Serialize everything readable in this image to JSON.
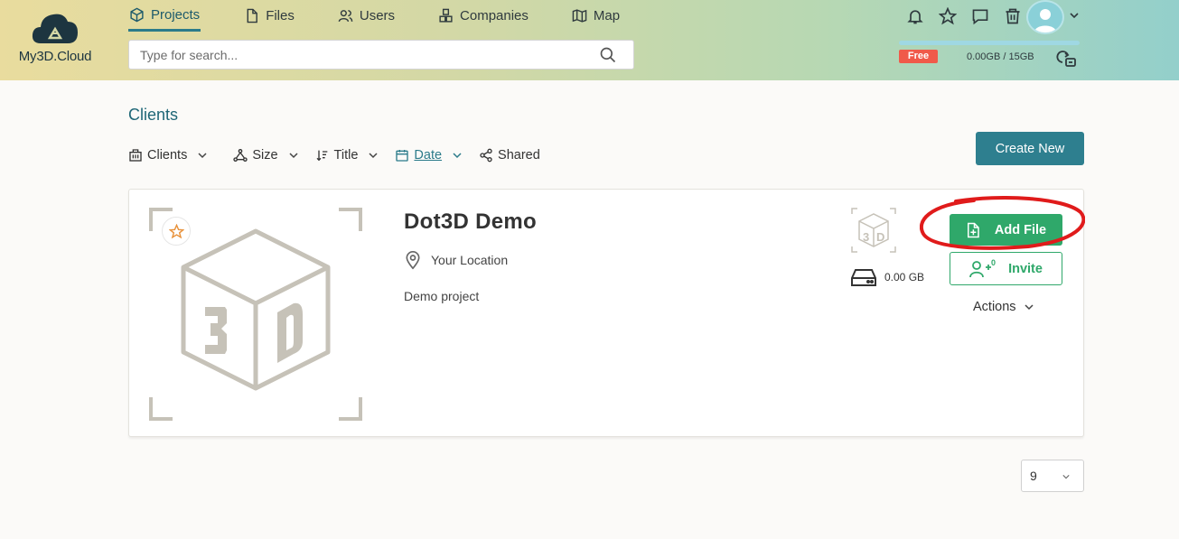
{
  "header": {
    "logo_text": "My3D.Cloud",
    "nav": [
      {
        "label": "Projects",
        "icon": "cube-icon",
        "active": true
      },
      {
        "label": "Files",
        "icon": "file-icon",
        "active": false
      },
      {
        "label": "Users",
        "icon": "users-icon",
        "active": false
      },
      {
        "label": "Companies",
        "icon": "boxes-icon",
        "active": false
      },
      {
        "label": "Map",
        "icon": "map-icon",
        "active": false
      }
    ],
    "search_placeholder": "Type for search...",
    "icons": [
      "bell-icon",
      "star-icon",
      "chat-icon",
      "trash-icon"
    ],
    "plan_badge": "Free",
    "storage_text": "0.00GB / 15GB",
    "storage_used_fraction": 0.0
  },
  "main": {
    "section_title": "Clients",
    "filters": [
      {
        "label": "Clients",
        "icon": "building-icon",
        "has_chevron": true
      },
      {
        "label": "Size",
        "icon": "network-icon",
        "has_chevron": true
      },
      {
        "label": "Title",
        "icon": "sort-icon",
        "has_chevron": true
      },
      {
        "label": "Date",
        "icon": "calendar-icon",
        "has_chevron": true,
        "active": true
      },
      {
        "label": "Shared",
        "icon": "share-icon",
        "has_chevron": false
      }
    ],
    "create_label": "Create New",
    "project": {
      "title": "Dot3D Demo",
      "location": "Your Location",
      "description": "Demo project",
      "size": "0.00 GB",
      "add_file_label": "Add File",
      "invite_label": "Invite",
      "invite_count": "0",
      "actions_label": "Actions"
    },
    "per_page": "9"
  },
  "colors": {
    "accent": "#2e7f8f",
    "add_button": "#2fa86a",
    "free_badge": "#f05a4a",
    "highlight": "#e01b1b"
  }
}
